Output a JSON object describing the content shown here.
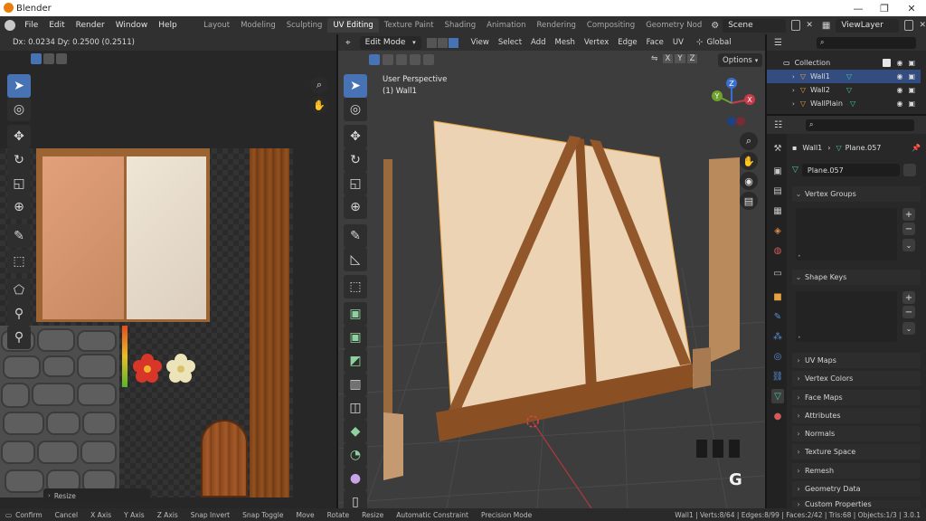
{
  "app": {
    "title": "Blender"
  },
  "window_controls": {
    "minimize": "—",
    "maximize": "❐",
    "close": "✕"
  },
  "menu": [
    "File",
    "Edit",
    "Render",
    "Window",
    "Help"
  ],
  "workspaces": [
    "Layout",
    "Modeling",
    "Sculpting",
    "UV Editing",
    "Texture Paint",
    "Shading",
    "Animation",
    "Rendering",
    "Compositing",
    "Geometry Nod"
  ],
  "active_workspace": "UV Editing",
  "scene": {
    "name": "Scene"
  },
  "view_layer": {
    "name": "ViewLayer"
  },
  "uv_editor": {
    "header_text": "Dx: 0.0234  Dy: 0.2500 (0.2511)",
    "operator_panel": "Resize"
  },
  "viewport": {
    "mode": "Edit Mode",
    "menus": [
      "View",
      "Select",
      "Add",
      "Mesh",
      "Vertex",
      "Edge",
      "Face",
      "UV"
    ],
    "transform_orientation": "Global",
    "axes": [
      "X",
      "Y",
      "Z"
    ],
    "options_label": "Options",
    "overlay_title": "User Perspective",
    "overlay_object": "(1) Wall1",
    "key_overlay": "G",
    "gizmo": {
      "x": "X",
      "y": "Y",
      "z": "Z"
    }
  },
  "outliner": {
    "collection": "Collection",
    "items": [
      "Wall1",
      "Wall2",
      "WallPlain"
    ],
    "selected": "Wall1"
  },
  "properties": {
    "breadcrumb_object": "Wall1",
    "breadcrumb_mesh": "Plane.057",
    "mesh_name": "Plane.057",
    "sections": [
      "Vertex Groups",
      "Shape Keys",
      "UV Maps",
      "Vertex Colors",
      "Face Maps",
      "Attributes",
      "Normals",
      "Texture Space",
      "Remesh",
      "Geometry Data",
      "Custom Properties"
    ]
  },
  "statusbar": {
    "left": [
      "Confirm",
      "Cancel",
      "X Axis",
      "Y Axis",
      "Z Axis",
      "Snap Invert",
      "Snap Toggle",
      "Move",
      "Rotate",
      "Resize",
      "Automatic Constraint",
      "Precision Mode"
    ],
    "right": "Wall1 | Verts:8/64 | Edges:8/99 | Faces:2/42 | Tris:68 | Objects:1/3 | 3.0.1"
  },
  "colors": {
    "accent": "#4772b3",
    "panel": "#303030",
    "viewport_bg": "#3d3d3d",
    "select_orange": "#e8a341"
  }
}
